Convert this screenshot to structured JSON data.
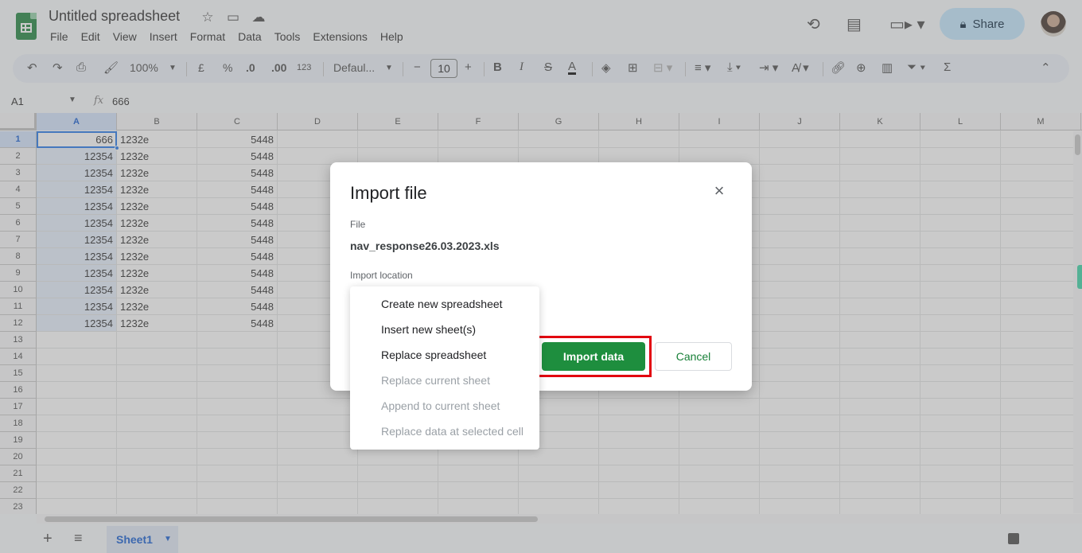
{
  "app": {
    "title": "Untitled spreadsheet",
    "menu": [
      "File",
      "Edit",
      "View",
      "Insert",
      "Format",
      "Data",
      "Tools",
      "Extensions",
      "Help"
    ],
    "share_label": "Share"
  },
  "toolbar": {
    "zoom": "100%",
    "currency": "£",
    "percent": "%",
    "dec_decrease": ".0",
    "dec_increase": ".00",
    "number_format": "123",
    "font": "Defaul...",
    "font_size": "10"
  },
  "formula_bar": {
    "name_box": "A1",
    "fx": "fx",
    "value": "666"
  },
  "grid": {
    "columns": [
      "A",
      "B",
      "C",
      "D",
      "E",
      "F",
      "G",
      "H",
      "I",
      "J",
      "K",
      "L",
      "M"
    ],
    "rows": [
      "1",
      "2",
      "3",
      "4",
      "5",
      "6",
      "7",
      "8",
      "9",
      "10",
      "11",
      "12",
      "13",
      "14",
      "15",
      "16",
      "17",
      "18",
      "19",
      "20",
      "21",
      "22",
      "23"
    ],
    "data": [
      [
        "666",
        "1232e",
        "5448"
      ],
      [
        "12354",
        "1232e",
        "5448"
      ],
      [
        "12354",
        "1232e",
        "5448"
      ],
      [
        "12354",
        "1232e",
        "5448"
      ],
      [
        "12354",
        "1232e",
        "5448"
      ],
      [
        "12354",
        "1232e",
        "5448"
      ],
      [
        "12354",
        "1232e",
        "5448"
      ],
      [
        "12354",
        "1232e",
        "5448"
      ],
      [
        "12354",
        "1232e",
        "5448"
      ],
      [
        "12354",
        "1232e",
        "5448"
      ],
      [
        "12354",
        "1232e",
        "5448"
      ],
      [
        "12354",
        "1232e",
        "5448"
      ]
    ]
  },
  "sheets": {
    "active": "Sheet1"
  },
  "dialog": {
    "title": "Import file",
    "close_label": "×",
    "file_label": "File",
    "file_name": "nav_response26.03.2023.xls",
    "location_label": "Import location",
    "import_label": "Import data",
    "cancel_label": "Cancel",
    "options": [
      {
        "label": "Create new spreadsheet",
        "enabled": true
      },
      {
        "label": "Insert new sheet(s)",
        "enabled": true
      },
      {
        "label": "Replace spreadsheet",
        "enabled": true
      },
      {
        "label": "Replace current sheet",
        "enabled": false
      },
      {
        "label": "Append to current sheet",
        "enabled": false
      },
      {
        "label": "Replace data at selected cell",
        "enabled": false
      }
    ]
  }
}
